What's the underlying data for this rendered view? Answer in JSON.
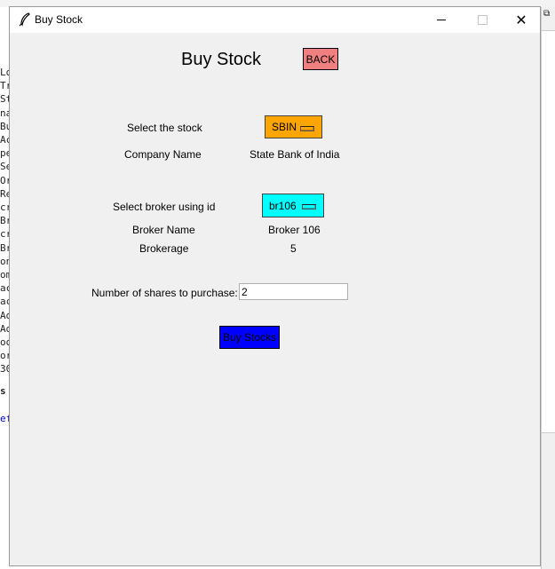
{
  "window": {
    "title": "Buy Stock",
    "controls": {
      "minimize": "─",
      "maximize": "☐",
      "close": "✕"
    }
  },
  "page": {
    "heading": "Buy Stock",
    "back_label": "BACK"
  },
  "stock": {
    "select_label": "Select the stock",
    "selected": "SBIN",
    "company_label": "Company Name",
    "company_value": "State Bank of India"
  },
  "broker": {
    "select_label": "Select broker using id",
    "selected": "br106",
    "name_label": "Broker Name",
    "name_value": "Broker 106",
    "brokerage_label": "Brokerage",
    "brokerage_value": "5"
  },
  "purchase": {
    "shares_label": "Number of shares to purchase:",
    "shares_value": "2",
    "buy_label": "Buy Stocks"
  },
  "background": {
    "left_fragments": [
      "Lo",
      "Tr",
      "St",
      "na",
      "Bu",
      "Ac",
      "pe",
      "Se",
      "Or",
      "Re",
      "cr",
      "Br",
      "cr",
      "Br",
      "on",
      "om",
      "ac",
      "ac",
      "Ad",
      "Ad",
      "oo",
      "or",
      "30"
    ],
    "fragment_s": "s",
    "fragment_ef": "ef"
  },
  "colors": {
    "back_button": "#f08080",
    "stock_menu": "#ffa500",
    "broker_menu": "#00ffff",
    "buy_button": "#0000ff",
    "window_bg": "#f0f0f0"
  }
}
